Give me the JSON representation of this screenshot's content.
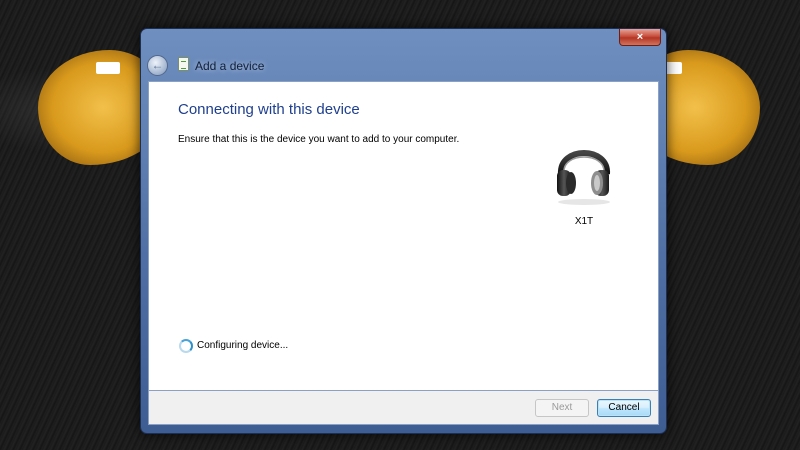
{
  "window": {
    "title": "Add a device",
    "close_glyph": "×",
    "back_glyph": "←"
  },
  "page": {
    "heading": "Connecting with this device",
    "instruction": "Ensure that this is the device you want to add to your computer."
  },
  "device": {
    "name": "X1T",
    "icon": "headphones-icon"
  },
  "status": {
    "text": "Configuring device...",
    "icon": "spinner-icon"
  },
  "buttons": {
    "next_label": "Next",
    "next_enabled": false,
    "cancel_label": "Cancel"
  },
  "colors": {
    "heading": "#1f3f8f",
    "title_bar": "#4e6ea3",
    "eye": "#d99a1c"
  }
}
